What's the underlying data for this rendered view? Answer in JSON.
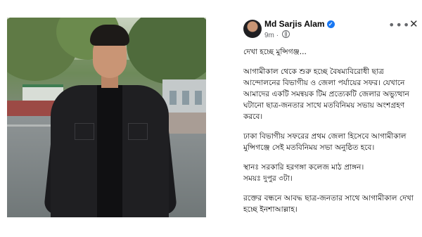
{
  "post": {
    "author": "Md Sarjis Alam",
    "time": "9m",
    "separator": "·",
    "lines": [
      "দেখা হচ্ছে মুন্সিগঞ্জ...",
      "আগামীকাল থেকে শুরু হচ্ছে বৈষম্যবিরোধী ছাত্র আন্দোলনের বিভাগীয় ও জেলা পর্যায়ের সফর। যেখানে আমাদের একটি সমন্বয়ক টিম প্রত্যেকটি জেলার অভ্যুত্থান ঘটানো ছাত্র-জনতার সাথে মতবিনিময় সভায় অংশগ্রহণ করবে।",
      "ঢাকা বিভাগীয় সফরের প্রথম জেলা হিসেবে আগামীকাল মুন্সিগঞ্জে সেই মতবিনিময় সভা অনুষ্ঠিত হবে।",
      "স্থানঃ সরকারি হরগঙ্গা কলেজ মাঠ প্রাঙ্গন।",
      "সময়ঃ দুপুর ৩টা।",
      "রক্তের বন্ধনে আবদ্ধ ছাত্র-জনতার সাথে আগামীকাল দেখা হচ্ছে ইনশাআল্লাহ।"
    ],
    "more_icon": "more-horizontal-icon",
    "close_icon": "close-icon",
    "verified_icon": "verified-badge-icon",
    "globe_icon": "globe-icon"
  },
  "colors": {
    "verified": "#1877f2",
    "meta": "#65676b",
    "text": "#050505"
  }
}
